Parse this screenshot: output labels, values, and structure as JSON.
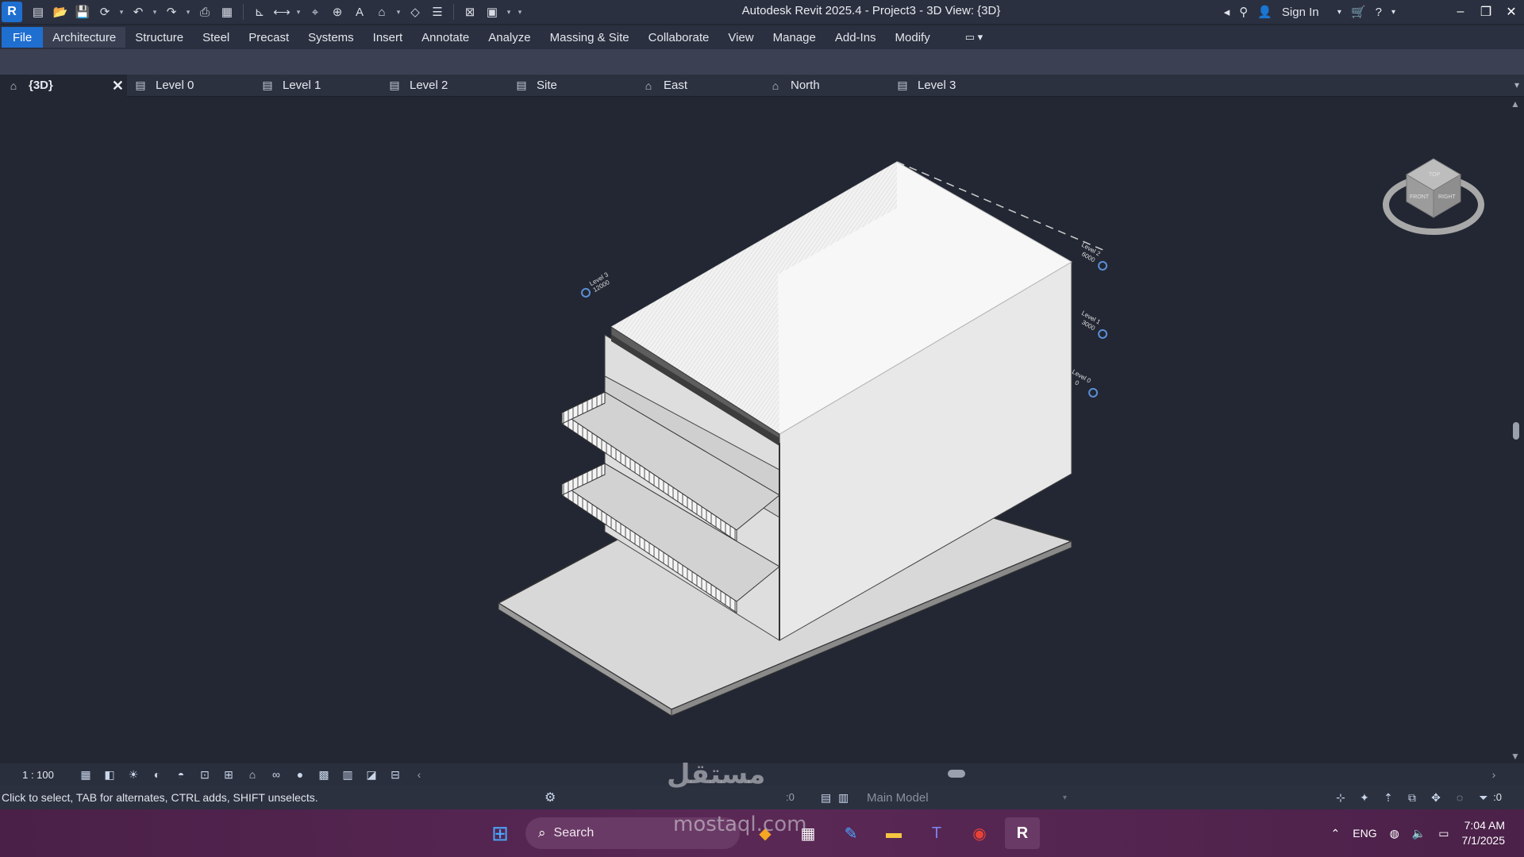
{
  "titlebar": {
    "title": "Autodesk Revit 2025.4 - Project3 - 3D View: {3D}",
    "logo": "R",
    "sign_in": "Sign In"
  },
  "ribbon": {
    "tabs": [
      "File",
      "Architecture",
      "Structure",
      "Steel",
      "Precast",
      "Systems",
      "Insert",
      "Annotate",
      "Analyze",
      "Massing & Site",
      "Collaborate",
      "View",
      "Manage",
      "Add-Ins",
      "Modify"
    ],
    "active": "Architecture"
  },
  "view_tabs": [
    {
      "label": "{3D}",
      "icon": "home-icon",
      "active": true
    },
    {
      "label": "Level 0",
      "icon": "floor-plan-icon"
    },
    {
      "label": "Level 1",
      "icon": "floor-plan-icon"
    },
    {
      "label": "Level 2",
      "icon": "floor-plan-icon"
    },
    {
      "label": "Site",
      "icon": "floor-plan-icon"
    },
    {
      "label": "East",
      "icon": "elevation-icon"
    },
    {
      "label": "North",
      "icon": "elevation-icon"
    },
    {
      "label": "Level 3",
      "icon": "floor-plan-icon"
    }
  ],
  "levels": [
    {
      "name": "Level 3",
      "elevation": "12000"
    },
    {
      "name": "Level 2",
      "elevation": "6000"
    },
    {
      "name": "Level 1",
      "elevation": "3000"
    },
    {
      "name": "Level 0",
      "elevation": "0"
    }
  ],
  "viewcube": {
    "faces": [
      "TOP",
      "FRONT",
      "RIGHT"
    ]
  },
  "view_control": {
    "scale": "1 : 100"
  },
  "status": {
    "message": "Click to select, TAB for alternates, CTRL adds, SHIFT unselects.",
    "count": ":0",
    "model": "Main Model",
    "filter_count": ":0"
  },
  "taskbar": {
    "search": "Search",
    "lang": "ENG",
    "time": "7:04 AM",
    "date": "7/1/2025"
  },
  "watermark": {
    "arabic": "مستقل",
    "latin": "mostaql.com"
  },
  "colors": {
    "accent": "#1f6fd1",
    "canvas": "#222733",
    "taskbar": "#4a2048"
  }
}
